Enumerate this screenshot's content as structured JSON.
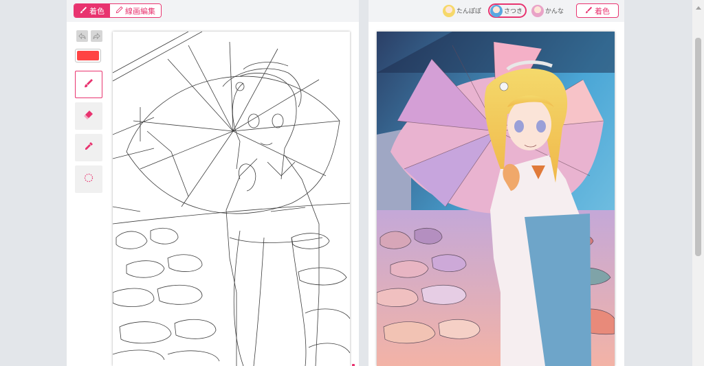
{
  "app": {
    "accent_color": "#e8336f",
    "background_color": "#e3e6ea"
  },
  "mode_tabs": [
    {
      "label": "着色",
      "icon": "brush-icon",
      "active": true
    },
    {
      "label": "線画編集",
      "icon": "pen-icon",
      "active": false
    }
  ],
  "tools": {
    "undo_icon": "undo-icon",
    "redo_icon": "redo-icon",
    "current_color": "#ff4444",
    "items": [
      {
        "icon": "brush-icon",
        "selected": true
      },
      {
        "icon": "eraser-icon",
        "selected": false
      },
      {
        "icon": "eyedropper-icon",
        "selected": false
      },
      {
        "icon": "dashed-circle-icon",
        "selected": false
      }
    ]
  },
  "styles": [
    {
      "label": "たんぽぽ",
      "avatar_color": "#f6d86a",
      "active": false
    },
    {
      "label": "さつき",
      "avatar_color": "#5aa7e0",
      "active": true
    },
    {
      "label": "かんな",
      "avatar_color": "#e9a3c7",
      "active": false
    }
  ],
  "color_button": {
    "label": "着色",
    "icon": "brush-icon"
  }
}
